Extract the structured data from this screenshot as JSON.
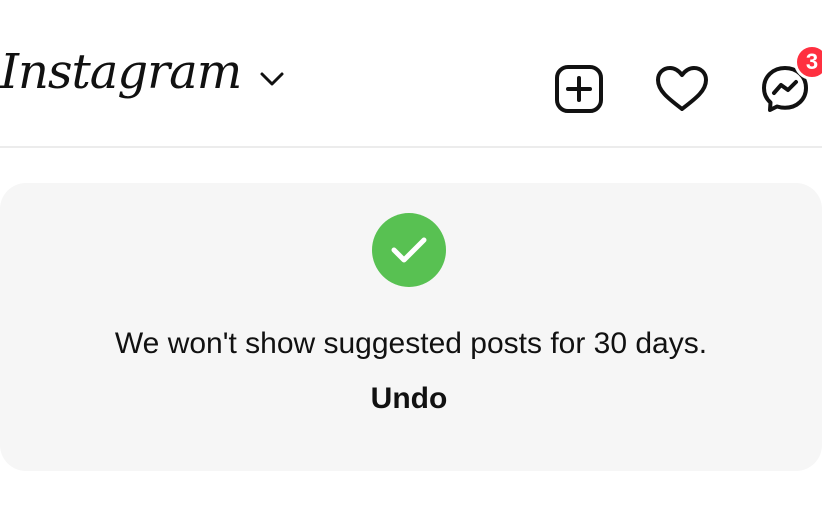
{
  "header": {
    "logo_text": "Instagram",
    "icons": {
      "switcher": "chevron-down-icon",
      "create": "plus-square-icon",
      "notifications": "heart-icon",
      "messages": "messenger-icon"
    },
    "messages_badge_count": "3",
    "badge_color": "#ff3040"
  },
  "notice": {
    "status_icon": "check-icon",
    "status_color": "#58c152",
    "message": "We won't show suggested posts for 30 days.",
    "undo_label": "Undo"
  }
}
